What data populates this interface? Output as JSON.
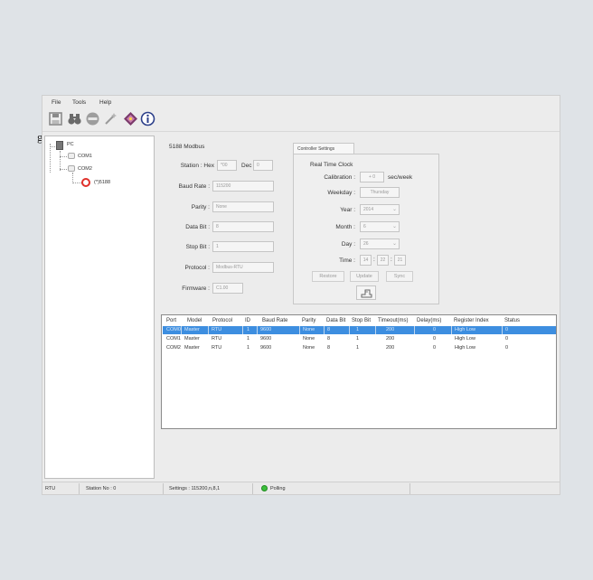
{
  "stray_char": "g",
  "menu": [
    "File",
    "Tools",
    "Help"
  ],
  "toolbar_icons": [
    "save-icon",
    "binoculars-icon",
    "stop-icon",
    "wand-icon",
    "book-icon",
    "info-icon"
  ],
  "tree": {
    "root": "PC",
    "com1": "COM1",
    "com2": "COM2",
    "device": "(*)5188"
  },
  "device_panel": {
    "title": "5188 Modbus",
    "station_label": "Station : Hex",
    "station_hex": "*00",
    "dec_label": "Dec",
    "station_dec": "0",
    "baud_label": "Baud Rate :",
    "baud_value": "115200",
    "parity_label": "Parity :",
    "parity_value": "None",
    "databit_label": "Data Bit :",
    "databit_value": "8",
    "stopbit_label": "Stop Bit :",
    "stopbit_value": "1",
    "protocol_label": "Protocol :",
    "protocol_value": "Modbus-RTU",
    "firmware_label": "Firmware :",
    "firmware_value": "C1.00"
  },
  "controller": {
    "tab": "Controller Settings",
    "rtc_title": "Real Time Clock",
    "calibration_label": "Calibration :",
    "calibration_value": "+ 0",
    "calibration_unit": "sec/week",
    "weekday_label": "Weekday :",
    "weekday_value": "Thursday",
    "year_label": "Year :",
    "year_value": "2014",
    "month_label": "Month :",
    "month_value": "6",
    "day_label": "Day :",
    "day_value": "26",
    "time_label": "Time :",
    "time_h": "14",
    "time_m": "22",
    "time_s": "21",
    "restore": "Restore",
    "update": "Update",
    "sync": "Sync"
  },
  "table": {
    "headers": [
      "Port",
      "Model",
      "Protocol",
      "ID",
      "Baud Rate",
      "Parity",
      "Data Bit",
      "Stop Bit",
      "Timeout(ms)",
      "Delay(ms)",
      "Register Index",
      "Status"
    ],
    "rows": [
      [
        "COM0",
        "Master",
        "RTU",
        "1",
        "9600",
        "None",
        "8",
        "1",
        "200",
        "0",
        "High Low",
        "0"
      ],
      [
        "COM1",
        "Master",
        "RTU",
        "1",
        "9600",
        "None",
        "8",
        "1",
        "200",
        "0",
        "High Low",
        "0"
      ],
      [
        "COM2",
        "Master",
        "RTU",
        "1",
        "9600",
        "None",
        "8",
        "1",
        "200",
        "0",
        "High Low",
        "0"
      ]
    ]
  },
  "status": {
    "mode": "RTU",
    "station": "Station No : 0",
    "settings": "Settings : 115200,n,8,1",
    "polling": "Polling"
  }
}
